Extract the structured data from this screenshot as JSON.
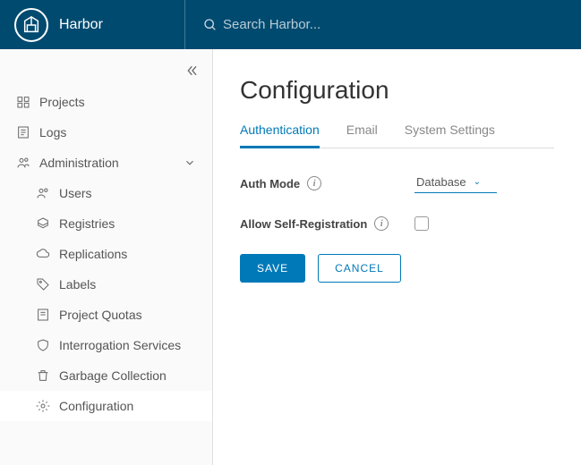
{
  "header": {
    "app_name": "Harbor",
    "search_placeholder": "Search Harbor..."
  },
  "sidebar": {
    "items": [
      {
        "label": "Projects"
      },
      {
        "label": "Logs"
      },
      {
        "label": "Administration"
      }
    ],
    "admin_items": [
      {
        "label": "Users"
      },
      {
        "label": "Registries"
      },
      {
        "label": "Replications"
      },
      {
        "label": "Labels"
      },
      {
        "label": "Project Quotas"
      },
      {
        "label": "Interrogation Services"
      },
      {
        "label": "Garbage Collection"
      },
      {
        "label": "Configuration"
      }
    ]
  },
  "main": {
    "title": "Configuration",
    "tabs": [
      {
        "label": "Authentication"
      },
      {
        "label": "Email"
      },
      {
        "label": "System Settings"
      }
    ],
    "form": {
      "auth_mode_label": "Auth Mode",
      "auth_mode_value": "Database",
      "allow_self_reg_label": "Allow Self-Registration",
      "allow_self_reg_checked": false,
      "save_label": "SAVE",
      "cancel_label": "CANCEL"
    }
  }
}
